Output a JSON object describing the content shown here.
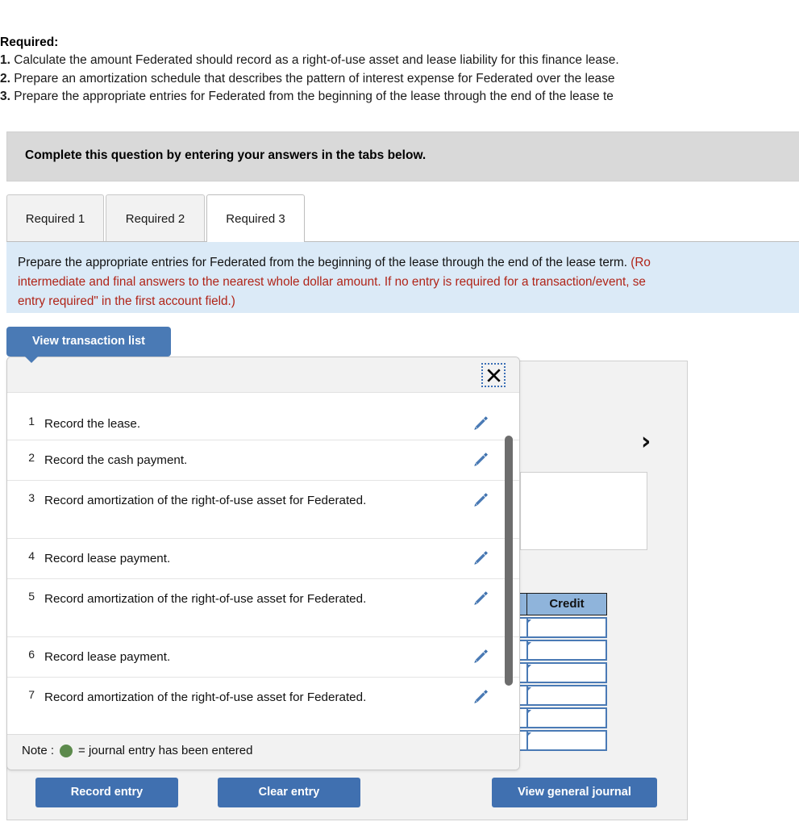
{
  "required": {
    "heading": "Required:",
    "items": [
      {
        "num": "1.",
        "text": "Calculate the amount Federated should record as a right-of-use asset and lease liability for this finance lease."
      },
      {
        "num": "2.",
        "text": "Prepare an amortization schedule that describes the pattern of interest expense for Federated over the lease"
      },
      {
        "num": "3.",
        "text": "Prepare the appropriate entries for Federated from the beginning of the lease through the end of the lease te"
      }
    ]
  },
  "banner": {
    "text": "Complete this question by entering your answers in the tabs below."
  },
  "tabs": [
    {
      "label": "Required 1",
      "active": false
    },
    {
      "label": "Required 2",
      "active": false
    },
    {
      "label": "Required 3",
      "active": true
    }
  ],
  "instruction": {
    "line1_black": "Prepare the appropriate entries for Federated from the beginning of the lease through the end of the lease term. ",
    "line1_red": "(Ro",
    "line2_red": "intermediate and final answers to the nearest whole dollar amount. If no entry is required for a transaction/event, se",
    "line3_red": "entry required\" in the first account field.)"
  },
  "toolbar": {
    "view_transaction_list": "View transaction list"
  },
  "transaction_list": {
    "close_icon": "close-icon",
    "rows": [
      {
        "num": "1",
        "text": "Record the lease."
      },
      {
        "num": "2",
        "text": "Record the cash payment."
      },
      {
        "num": "3",
        "text": "Record amortization of the right-of-use asset for Federated."
      },
      {
        "num": "4",
        "text": "Record lease payment."
      },
      {
        "num": "5",
        "text": "Record amortization of the right-of-use asset for Federated."
      },
      {
        "num": "6",
        "text": "Record lease payment."
      },
      {
        "num": "7",
        "text": "Record amortization of the right-of-use asset for Federated."
      }
    ],
    "note_prefix": "Note : ",
    "note_suffix": " = journal entry has been entered"
  },
  "journal_table": {
    "headers": [
      "",
      "Credit"
    ],
    "row_count": 6
  },
  "navigation": {
    "next_chevron": "chevron-right-icon"
  },
  "buttons": {
    "record_entry": "Record entry",
    "clear_entry": "Clear entry",
    "view_general_journal": "View general journal"
  },
  "colors": {
    "primary_blue": "#4070b0",
    "popover_blue": "#4a7ab5",
    "table_header_blue": "#8fb4db",
    "instruction_bg": "#dbeaf7",
    "instruction_red": "#b02418",
    "banner_gray": "#d9d9d9",
    "entered_green": "#5c8a4c"
  }
}
